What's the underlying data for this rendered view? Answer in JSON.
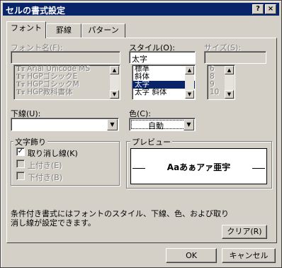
{
  "window": {
    "title": "セルの書式設定",
    "help_label": "?",
    "close_label": "×"
  },
  "tabs": [
    "フォント",
    "罫線",
    "パターン"
  ],
  "font_name": {
    "label": "フォント名(F):",
    "value": "",
    "options": [
      "Arial Unicode MS",
      "HGPゴシックE",
      "HGPゴシックM",
      "HGP教科書体"
    ]
  },
  "style": {
    "label": "スタイル(O):",
    "value": "太字",
    "options": [
      "標準",
      "斜体",
      "太字",
      "太字 斜体"
    ],
    "selected_index": 2
  },
  "size": {
    "label": "サイズ(S):",
    "value": "",
    "options": [
      "6",
      "8",
      "9",
      "10"
    ]
  },
  "underline": {
    "label": "下線(U):",
    "value": ""
  },
  "color": {
    "label": "色(C):",
    "value": "自動"
  },
  "effects": {
    "title": "文字飾り",
    "strikethrough": {
      "label": "取り消し線(K)",
      "checked": true
    },
    "superscript": {
      "label": "上付き(E)",
      "checked": false
    },
    "subscript": {
      "label": "下付き(B)",
      "checked": false
    }
  },
  "preview": {
    "label": "プレビュー",
    "sample": "Aaあぁアァ亜宇"
  },
  "info_text": {
    "line1": "条件付き書式にはフォントのスタイル、下線、色、および取り",
    "line2": "消し線が設定できます。"
  },
  "buttons": {
    "clear": "クリア(R)",
    "ok": "OK",
    "cancel": "キャンセル"
  },
  "glyphs": {
    "up": "▲",
    "down": "▼",
    "font_type_icon": "Tт",
    "checkmark": "✓"
  }
}
